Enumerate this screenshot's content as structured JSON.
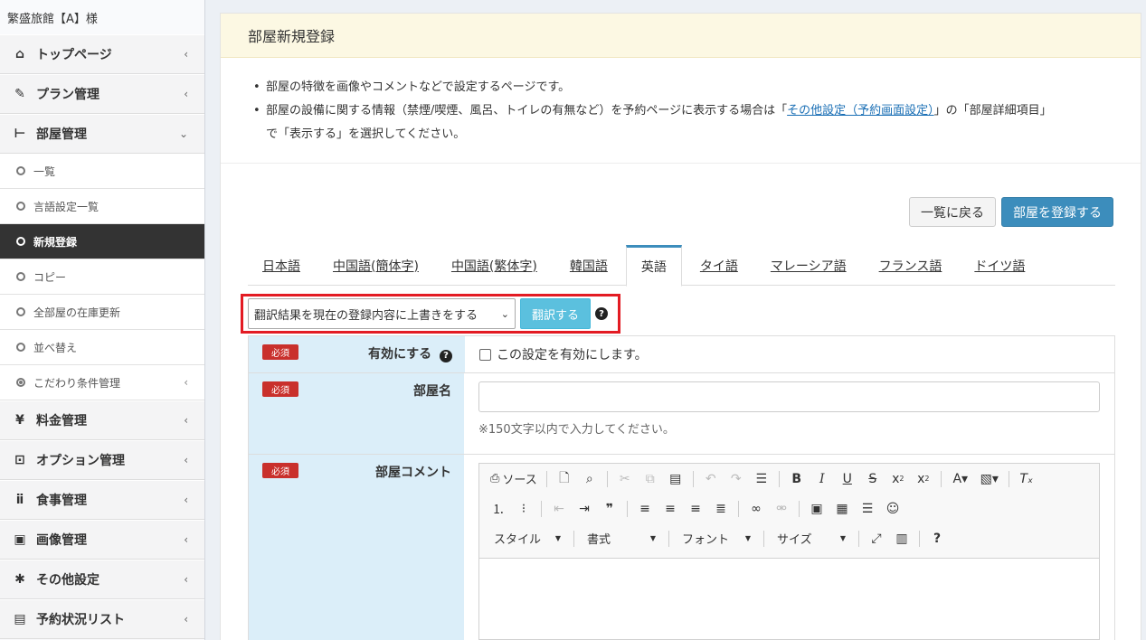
{
  "sidebar": {
    "hotel_name": "繁盛旅館【A】様",
    "items": [
      {
        "type": "main",
        "icon": "home-icon",
        "glyph": "⌂",
        "label": "トップページ",
        "chevron": "‹"
      },
      {
        "type": "main",
        "icon": "edit-icon",
        "glyph": "✎",
        "label": "プラン管理",
        "chevron": "‹"
      },
      {
        "type": "main",
        "icon": "bed-icon",
        "glyph": "⊢",
        "label": "部屋管理",
        "chevron": "⌄"
      },
      {
        "type": "sub",
        "label": "一覧"
      },
      {
        "type": "sub",
        "label": "言語設定一覧"
      },
      {
        "type": "sub",
        "label": "新規登録",
        "active": true
      },
      {
        "type": "sub",
        "label": "コピー"
      },
      {
        "type": "sub",
        "label": "全部屋の在庫更新"
      },
      {
        "type": "sub",
        "label": "並べ替え"
      },
      {
        "type": "sub",
        "label": "こだわり条件管理",
        "dot": true,
        "chevron": "‹"
      },
      {
        "type": "main",
        "icon": "yen-icon",
        "glyph": "¥",
        "label": "料金管理",
        "chevron": "‹"
      },
      {
        "type": "main",
        "icon": "cart-icon",
        "glyph": "⊡",
        "label": "オプション管理",
        "chevron": "‹"
      },
      {
        "type": "main",
        "icon": "cutlery-icon",
        "glyph": "ⅱ",
        "label": "食事管理",
        "chevron": "‹"
      },
      {
        "type": "main",
        "icon": "image-icon",
        "glyph": "▣",
        "label": "画像管理",
        "chevron": "‹"
      },
      {
        "type": "main",
        "icon": "gear-icon",
        "glyph": "✱",
        "label": "その他設定",
        "chevron": "‹"
      },
      {
        "type": "main",
        "icon": "book-icon",
        "glyph": "▤",
        "label": "予約状況リスト",
        "chevron": "‹"
      }
    ]
  },
  "header": {
    "title": "部屋新規登録"
  },
  "info": {
    "line1": "部屋の特徴を画像やコメントなどで設定するページです。",
    "line2_pre": "部屋の設備に関する情報（禁煙/喫煙、風呂、トイレの有無など）を予約ページに表示する場合は「",
    "line2_link": "その他設定（予約画面設定）",
    "line2_post": "」の「部屋詳細項目」",
    "line3": "で「表示する」を選択してください。"
  },
  "actions": {
    "back_label": "一覧に戻る",
    "register_label": "部屋を登録する"
  },
  "tabs": [
    "日本語",
    "中国語(簡体字)",
    "中国語(繁体字)",
    "韓国語",
    "英語",
    "タイ語",
    "マレーシア語",
    "フランス語",
    "ドイツ語"
  ],
  "active_tab": "英語",
  "translate": {
    "select_value": "翻訳結果を現在の登録内容に上書きをする",
    "button_label": "翻訳する",
    "help_glyph": "?"
  },
  "form": {
    "required_badge": "必須",
    "enable_label": "有効にする",
    "enable_checkbox_label": "この設定を有効にします。",
    "room_name_label": "部屋名",
    "room_name_hint": "※150文字以内で入力してください。",
    "room_comment_label": "部屋コメント"
  },
  "editor": {
    "source_label": "ソース",
    "combos": {
      "style": "スタイル",
      "format": "書式",
      "font": "フォント",
      "size": "サイズ"
    }
  },
  "colors": {
    "accent": "#3c8dbc",
    "info": "#5bc0de",
    "required": "#c9302c",
    "highlight": "#e31b23",
    "label_bg": "#dbeef9",
    "header_bg": "#fcf8e3"
  }
}
